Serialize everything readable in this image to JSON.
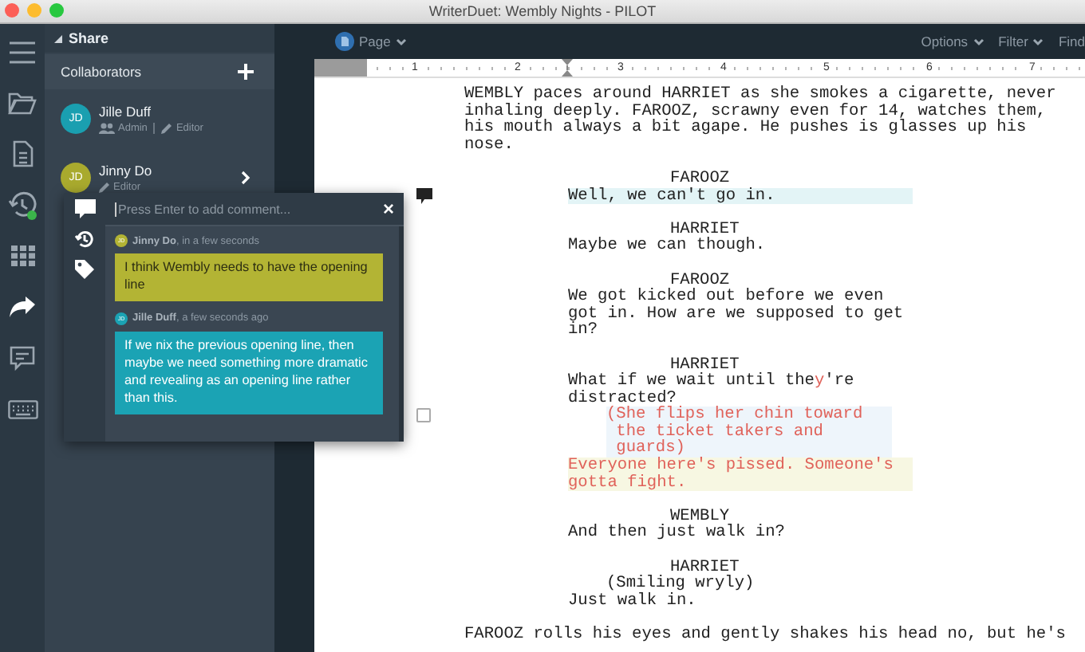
{
  "window": {
    "title": "WriterDuet: Wembly Nights - PILOT"
  },
  "rail": [
    {
      "kind": "menu",
      "selected": false
    },
    {
      "kind": "folder",
      "selected": false
    },
    {
      "kind": "document",
      "selected": false
    },
    {
      "kind": "history",
      "selected": false
    },
    {
      "kind": "grid",
      "selected": false
    },
    {
      "kind": "share",
      "selected": true
    },
    {
      "kind": "comment",
      "selected": false
    },
    {
      "kind": "keyboard",
      "selected": false
    }
  ],
  "sidebar": {
    "header": "Share",
    "section": "Collaborators",
    "collaborators": [
      {
        "initials": "JD",
        "name": "Jille Duff",
        "color": "#1a9fb0",
        "expandable": false,
        "roles": [
          {
            "kind": "admin",
            "label": "Admin"
          },
          {
            "kind": "editor",
            "label": "Editor"
          }
        ]
      },
      {
        "initials": "JD",
        "name": "Jinny Do",
        "color": "#a9aa2e",
        "expandable": true,
        "roles": [
          {
            "kind": "editor",
            "label": "Editor"
          }
        ]
      }
    ]
  },
  "comment_popup": {
    "tabs": [
      {
        "kind": "comment"
      },
      {
        "kind": "history"
      },
      {
        "kind": "tag"
      }
    ],
    "placeholder": "Press Enter to add comment...",
    "close": "×",
    "comments": [
      {
        "initials": "JD",
        "meta": "**Jinny Do**, in a few seconds",
        "color": "#b3b434",
        "text": "I think Wembly needs to have the opening line"
      },
      {
        "initials": "JD",
        "meta": "**Jille Duff**, a few seconds ago",
        "color": "#1ba3b4",
        "text": "If we nix the previous opening line, then maybe we need something more dramatic and revealing as an opening line rather than this."
      }
    ]
  },
  "toolbar": {
    "page": "Page",
    "right": [
      "Options",
      "Filter",
      "Find"
    ]
  },
  "ruler": {
    "labels": [
      "1",
      "2",
      "3",
      "4",
      "5",
      "6",
      "7"
    ]
  },
  "script": [
    {
      "kind": "action",
      "parts": [
        {
          "text": "WEMBLY paces around HARRIET as she smokes a cigarette, never inhaling deeply. FAROOZ, scrawny even for 14, watches them, his mouth always a bit agape. He pushes is glasses up his nose.",
          "revised": false
        }
      ]
    },
    {
      "kind": "character",
      "parts": [
        {
          "text": "FAROOZ",
          "revised": false
        }
      ]
    },
    {
      "kind": "dialogue",
      "color": "#e3f4f6",
      "marker": {
        "kind": "comment"
      },
      "parts": [
        {
          "text": "Well, we can't go in.",
          "revised": false
        }
      ]
    },
    {
      "kind": "character",
      "parts": [
        {
          "text": "HARRIET",
          "revised": false
        }
      ]
    },
    {
      "kind": "dialogue",
      "parts": [
        {
          "text": "Maybe we can though.",
          "revised": false
        }
      ]
    },
    {
      "kind": "character",
      "parts": [
        {
          "text": "FAROOZ",
          "revised": false
        }
      ]
    },
    {
      "kind": "dialogue",
      "parts": [
        {
          "text": "We got kicked out before we even got in. How are we supposed to get in?",
          "revised": false
        }
      ]
    },
    {
      "kind": "character",
      "parts": [
        {
          "text": "HARRIET",
          "revised": false
        }
      ]
    },
    {
      "kind": "dialogue",
      "parts": [
        {
          "text": "What if we wait until the",
          "revised": false
        },
        {
          "text": "y",
          "revised": true
        },
        {
          "text": "'re distracted?",
          "revised": false
        }
      ]
    },
    {
      "kind": "parenthetical",
      "color": "#eef5fb",
      "marker": {
        "kind": "checkbox",
        "checked": false
      },
      "parts": [
        {
          "text": "(She flips her chin toward the ticket takers and guards)",
          "revised": true
        }
      ]
    },
    {
      "kind": "dialogue",
      "color": "#f7f7e2",
      "parts": [
        {
          "text": "Everyone here's pissed. Someone's gotta fight.",
          "revised": true
        }
      ]
    },
    {
      "kind": "character",
      "parts": [
        {
          "text": "WEMBLY",
          "revised": false
        }
      ]
    },
    {
      "kind": "dialogue",
      "parts": [
        {
          "text": "And then just walk in?",
          "revised": false
        }
      ]
    },
    {
      "kind": "character",
      "parts": [
        {
          "text": "HARRIET",
          "revised": false
        }
      ]
    },
    {
      "kind": "parenthetical",
      "parts": [
        {
          "text": "(Smiling wryly)",
          "revised": false
        }
      ]
    },
    {
      "kind": "dialogue",
      "parts": [
        {
          "text": "Just walk in.",
          "revised": false
        }
      ]
    },
    {
      "kind": "action",
      "parts": [
        {
          "text": "FAROOZ rolls his eyes and gently shakes his head no, but he's",
          "revised": false
        }
      ]
    }
  ]
}
